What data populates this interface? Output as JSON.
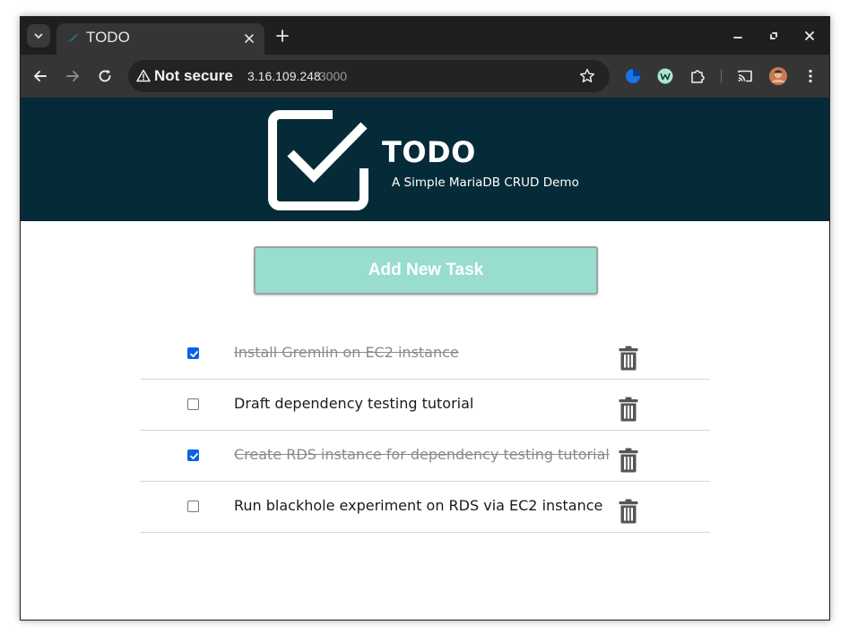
{
  "browser": {
    "tab_title": "TODO",
    "url_security": "Not secure",
    "url_host": "3.16.109.248",
    "url_port": ":3000"
  },
  "app": {
    "title": "TODO",
    "subtitle": "A Simple MariaDB CRUD Demo",
    "add_button_label": "Add New Task",
    "colors": {
      "header_bg": "#062b38",
      "button_bg": "#98ddd0",
      "checkbox_checked": "#0b62e4"
    }
  },
  "tasks": [
    {
      "text": "Install Gremlin on EC2 instance",
      "completed": true
    },
    {
      "text": "Draft dependency testing tutorial",
      "completed": false
    },
    {
      "text": "Create RDS instance for dependency testing tutorial",
      "completed": true
    },
    {
      "text": "Run blackhole experiment on RDS via EC2 instance",
      "completed": false
    }
  ],
  "icons": {
    "tab_search": "chevron-down-icon",
    "favicon": "mariadb-seal-icon",
    "tab_close": "close-icon",
    "new_tab": "plus-icon",
    "back": "arrow-left-icon",
    "forward": "arrow-right-icon",
    "reload": "reload-icon",
    "warning": "warning-triangle-icon",
    "bookmark": "star-icon",
    "extensions": [
      "pie-extension-icon",
      "w-extension-icon",
      "puzzle-icon"
    ],
    "cast": "cast-icon",
    "profile": "avatar",
    "menu": "kebab-menu-icon",
    "task_delete": "trash-icon",
    "logo": "checkbox-logo-icon"
  }
}
